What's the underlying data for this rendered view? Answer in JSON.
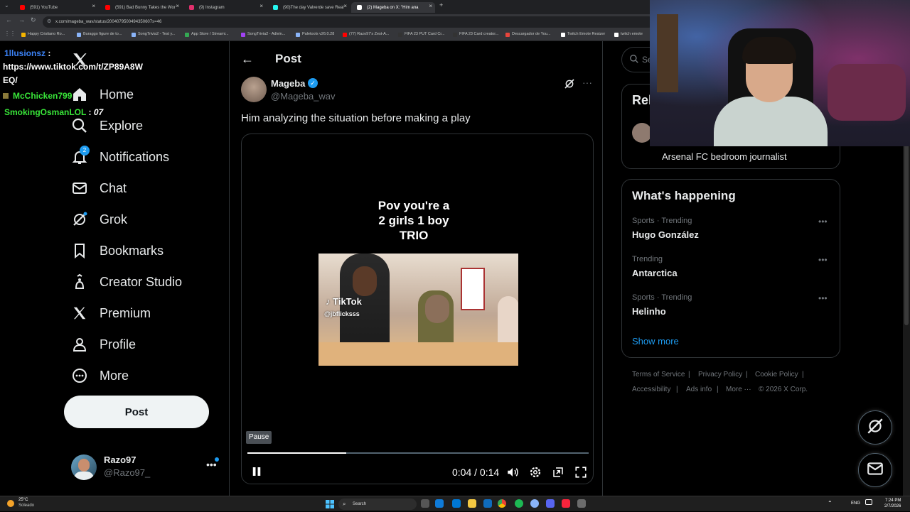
{
  "browser": {
    "tabs": [
      {
        "label": "(591) YouTube",
        "color": "#ff0000"
      },
      {
        "label": "(591) Bad Bunny Takes the Wor",
        "color": "#ff0000"
      },
      {
        "label": "(9) Instagram",
        "color": "#e1306c"
      },
      {
        "label": "(90)The day Valverde save Real",
        "color": "#ffffff"
      },
      {
        "label": "(2) Mageba on X: \"Him ana",
        "color": "#ffffff"
      }
    ],
    "new_tab_glyph": "+",
    "url": "x.com/mageba_wav/status/2004079500494350607s=46",
    "bookmarks": [
      "Happy Cristiano Ro...",
      "Buraggo figure de to...",
      "SongTrivia2 - Test y...",
      "App Store / Streami...",
      "SongTrivia2 - Adivin...",
      "Paletools v26.0.28",
      "(77) Razo97's Zest-A...",
      "FIFA 23 PUT Card Cr...",
      "FIFA 23 Card creator...",
      "Descargador de You...",
      "Twitch Emote Resizer",
      "twitch emote"
    ]
  },
  "chat_overlay": [
    {
      "user": "1llusionsz",
      "sep": " :",
      "color": "#3b82f6"
    },
    {
      "text": "https://www.tiktok.com/t/ZP89A8W"
    },
    {
      "text": "EQ/"
    },
    {
      "user": "McChicken799",
      "color": "#39e639"
    },
    {
      "user": "SmokingOsmanLOL",
      "sep": " :",
      "msg": "07",
      "color": "#39e639"
    }
  ],
  "nav": {
    "items": [
      {
        "label": "Home",
        "icon": "home-icon"
      },
      {
        "label": "Explore",
        "icon": "search-icon"
      },
      {
        "label": "Notifications",
        "icon": "bell-icon",
        "badge": "2"
      },
      {
        "label": "Chat",
        "icon": "mail-icon"
      },
      {
        "label": "Grok",
        "icon": "grok-icon"
      },
      {
        "label": "Bookmarks",
        "icon": "bookmark-icon"
      },
      {
        "label": "Creator Studio",
        "icon": "creator-studio-icon"
      },
      {
        "label": "Premium",
        "icon": "x-logo-icon"
      },
      {
        "label": "Profile",
        "icon": "person-icon"
      },
      {
        "label": "More",
        "icon": "more-circle-icon"
      }
    ],
    "post_button": "Post",
    "user": {
      "name": "Razo97",
      "handle": "@Razo97_",
      "more": "•••"
    }
  },
  "post": {
    "header_title": "Post",
    "author_name": "Mageba",
    "author_handle": "@Mageba_wav",
    "text": "Him analyzing the situation before making a play",
    "video": {
      "caption": "Pov you're a\n2 girls 1 boy\nTRIO",
      "tiktok_label": "TikTok",
      "tiktok_user": "@jbflicksss",
      "tooltip": "Pause",
      "time": "0:04 / 0:14",
      "progress": 0.29
    }
  },
  "sidebar": {
    "search_placeholder": "Search",
    "relevant_title": "Rel",
    "relevant_bio": "Arsenal FC bedroom journalist",
    "happening_title": "What's happening",
    "trends": [
      {
        "context": "Sports · Trending",
        "name": "Hugo González"
      },
      {
        "context": "Trending",
        "name": "Antarctica"
      },
      {
        "context": "Sports · Trending",
        "name": "Helinho"
      }
    ],
    "show_more": "Show more",
    "footer": [
      "Terms of Service",
      "|",
      "Privacy Policy",
      "|",
      "Cookie Policy",
      "|",
      "Accessibility",
      "|",
      "Ads info",
      "|",
      "More ···",
      "© 2026 X Corp."
    ]
  },
  "taskbar": {
    "temp": "25°C",
    "weather": "Soleado",
    "search": "Search",
    "lang": "ENG",
    "time": "7:24 PM",
    "date": "2/7/2026"
  },
  "colors": {
    "accent": "#1d9bf0",
    "background": "#000000",
    "border": "#2f3336",
    "muted": "#71767b"
  }
}
